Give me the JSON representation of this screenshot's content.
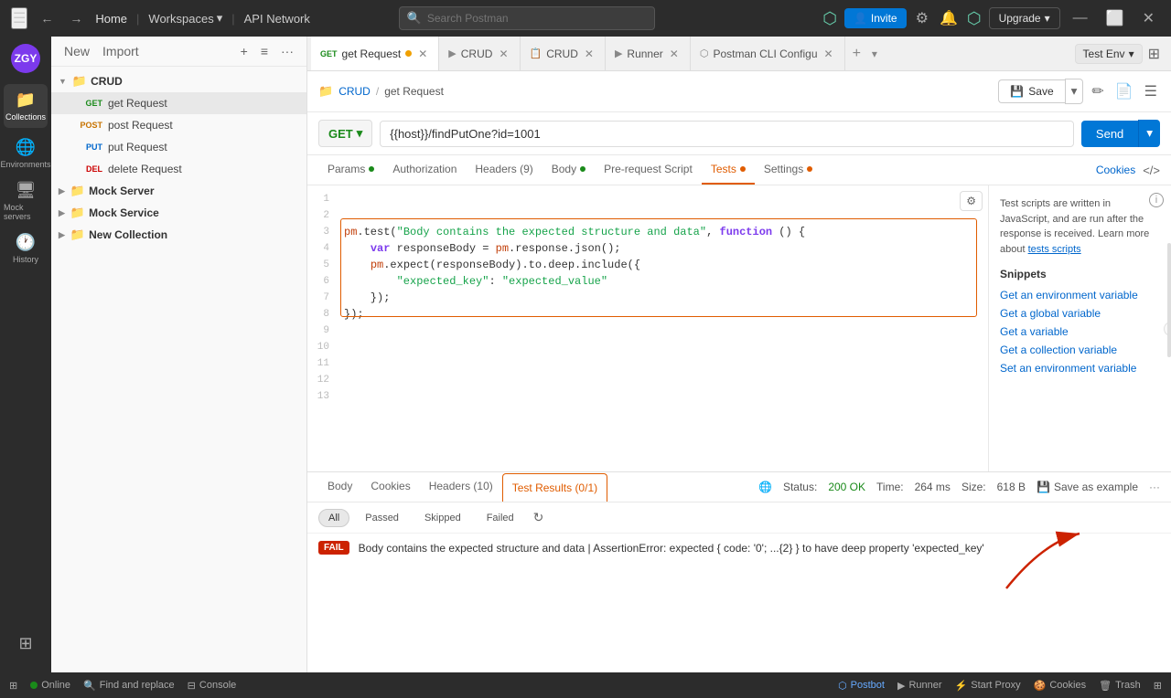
{
  "titlebar": {
    "menu_icon": "☰",
    "back": "←",
    "forward": "→",
    "home": "Home",
    "workspaces": "Workspaces",
    "api_network": "API Network",
    "search_placeholder": "Search Postman",
    "invite_label": "Invite",
    "upgrade_label": "Upgrade",
    "minimize": "—",
    "maximize": "⬜",
    "close": "✕"
  },
  "sidebar_icons": [
    {
      "id": "collections",
      "symbol": "📁",
      "label": "Collections",
      "active": true
    },
    {
      "id": "environments",
      "symbol": "🌐",
      "label": "Environments",
      "active": false
    },
    {
      "id": "mock-servers",
      "symbol": "🖥",
      "label": "Mock servers",
      "active": false
    },
    {
      "id": "history",
      "symbol": "🕐",
      "label": "History",
      "active": false
    },
    {
      "id": "other",
      "symbol": "⊞",
      "label": "",
      "active": false
    }
  ],
  "collections_panel": {
    "new_btn": "New",
    "import_btn": "Import",
    "user": "ZGY",
    "add_icon": "+",
    "filter_icon": "≡",
    "more_icon": "···",
    "tree": [
      {
        "id": "crud",
        "label": "CRUD",
        "expanded": true,
        "items": [
          {
            "method": "GET",
            "label": "get Request",
            "active": true
          },
          {
            "method": "POST",
            "label": "post Request",
            "active": false
          },
          {
            "method": "PUT",
            "label": "put Request",
            "active": false
          },
          {
            "method": "DEL",
            "label": "delete Request",
            "active": false
          }
        ]
      },
      {
        "id": "mock-server",
        "label": "Mock Server",
        "expanded": false,
        "items": []
      },
      {
        "id": "mock-service",
        "label": "Mock Service",
        "expanded": false,
        "items": []
      },
      {
        "id": "new-collection",
        "label": "New Collection",
        "expanded": false,
        "items": []
      }
    ]
  },
  "tabs": [
    {
      "id": "get-request",
      "method": "GET",
      "label": "get Request",
      "active": true,
      "dot": true
    },
    {
      "id": "crud-1",
      "method": "",
      "label": "CRUD",
      "active": false,
      "dot": false
    },
    {
      "id": "crud-2",
      "method": "",
      "label": "CRUD",
      "active": false,
      "dot": false
    },
    {
      "id": "runner",
      "method": "",
      "label": "Runner",
      "active": false,
      "dot": false
    },
    {
      "id": "postman-cli",
      "method": "",
      "label": "Postman CLI Configu",
      "active": false,
      "dot": false
    }
  ],
  "env_selector": {
    "label": "Test Env",
    "icon": "▾"
  },
  "request": {
    "breadcrumb_collection": "CRUD",
    "breadcrumb_request": "get Request",
    "method": "GET",
    "url": "{{host}}/findPutOne?id=1001",
    "send_label": "Send",
    "save_label": "Save"
  },
  "req_tabs": [
    {
      "id": "params",
      "label": "Params",
      "dot": true,
      "dot_color": "green"
    },
    {
      "id": "authorization",
      "label": "Authorization",
      "dot": false
    },
    {
      "id": "headers",
      "label": "Headers (9)",
      "dot": false
    },
    {
      "id": "body",
      "label": "Body",
      "dot": true,
      "dot_color": "green"
    },
    {
      "id": "pre-request",
      "label": "Pre-request Script",
      "dot": false
    },
    {
      "id": "tests",
      "label": "Tests",
      "dot": true,
      "dot_color": "orange",
      "active": true
    },
    {
      "id": "settings",
      "label": "Settings",
      "dot": true,
      "dot_color": "orange"
    }
  ],
  "cookies_link": "Cookies",
  "code_lines": [
    {
      "num": 1,
      "content": ""
    },
    {
      "num": 2,
      "content": ""
    },
    {
      "num": 3,
      "content": "pm.test(\"Body contains the expected structure and data\", function () {",
      "highlight_start": true
    },
    {
      "num": 4,
      "content": "    var responseBody = pm.response.json();"
    },
    {
      "num": 5,
      "content": "    pm.expect(responseBody).to.deep.include({"
    },
    {
      "num": 6,
      "content": "        \"expected_key\": \"expected_value\""
    },
    {
      "num": 7,
      "content": "    });"
    },
    {
      "num": 8,
      "content": "});",
      "highlight_end": true
    },
    {
      "num": 9,
      "content": ""
    },
    {
      "num": 10,
      "content": ""
    },
    {
      "num": 11,
      "content": ""
    },
    {
      "num": 12,
      "content": ""
    },
    {
      "num": 13,
      "content": ""
    }
  ],
  "snippets": {
    "description": "Test scripts are written in JavaScript, and are run after the response is received. Learn more about",
    "link": "tests scripts",
    "title": "Snippets",
    "items": [
      "Get an environment variable",
      "Get a global variable",
      "Get a variable",
      "Get a collection variable",
      "Set an environment variable"
    ]
  },
  "resp_tabs": [
    {
      "id": "body",
      "label": "Body"
    },
    {
      "id": "cookies",
      "label": "Cookies"
    },
    {
      "id": "headers",
      "label": "Headers (10)"
    },
    {
      "id": "test-results",
      "label": "Test Results (0/1)",
      "active": true
    }
  ],
  "resp_status": {
    "status": "200 OK",
    "time": "264 ms",
    "size": "618 B",
    "save_label": "Save as example"
  },
  "test_filters": [
    {
      "id": "all",
      "label": "All",
      "active": true
    },
    {
      "id": "passed",
      "label": "Passed",
      "active": false
    },
    {
      "id": "skipped",
      "label": "Skipped",
      "active": false
    },
    {
      "id": "failed",
      "label": "Failed",
      "active": false
    }
  ],
  "test_result": {
    "badge": "FAIL",
    "text": "Body contains the expected structure and data | AssertionError: expected { code: '0'; ...{2} } to have deep property 'expected_key'"
  },
  "status_bar": {
    "online": "Online",
    "find_replace": "Find and replace",
    "console": "Console",
    "postbot": "Postbot",
    "runner": "Runner",
    "start_proxy": "Start Proxy",
    "cookies": "Cookies",
    "trash": "Trash"
  }
}
